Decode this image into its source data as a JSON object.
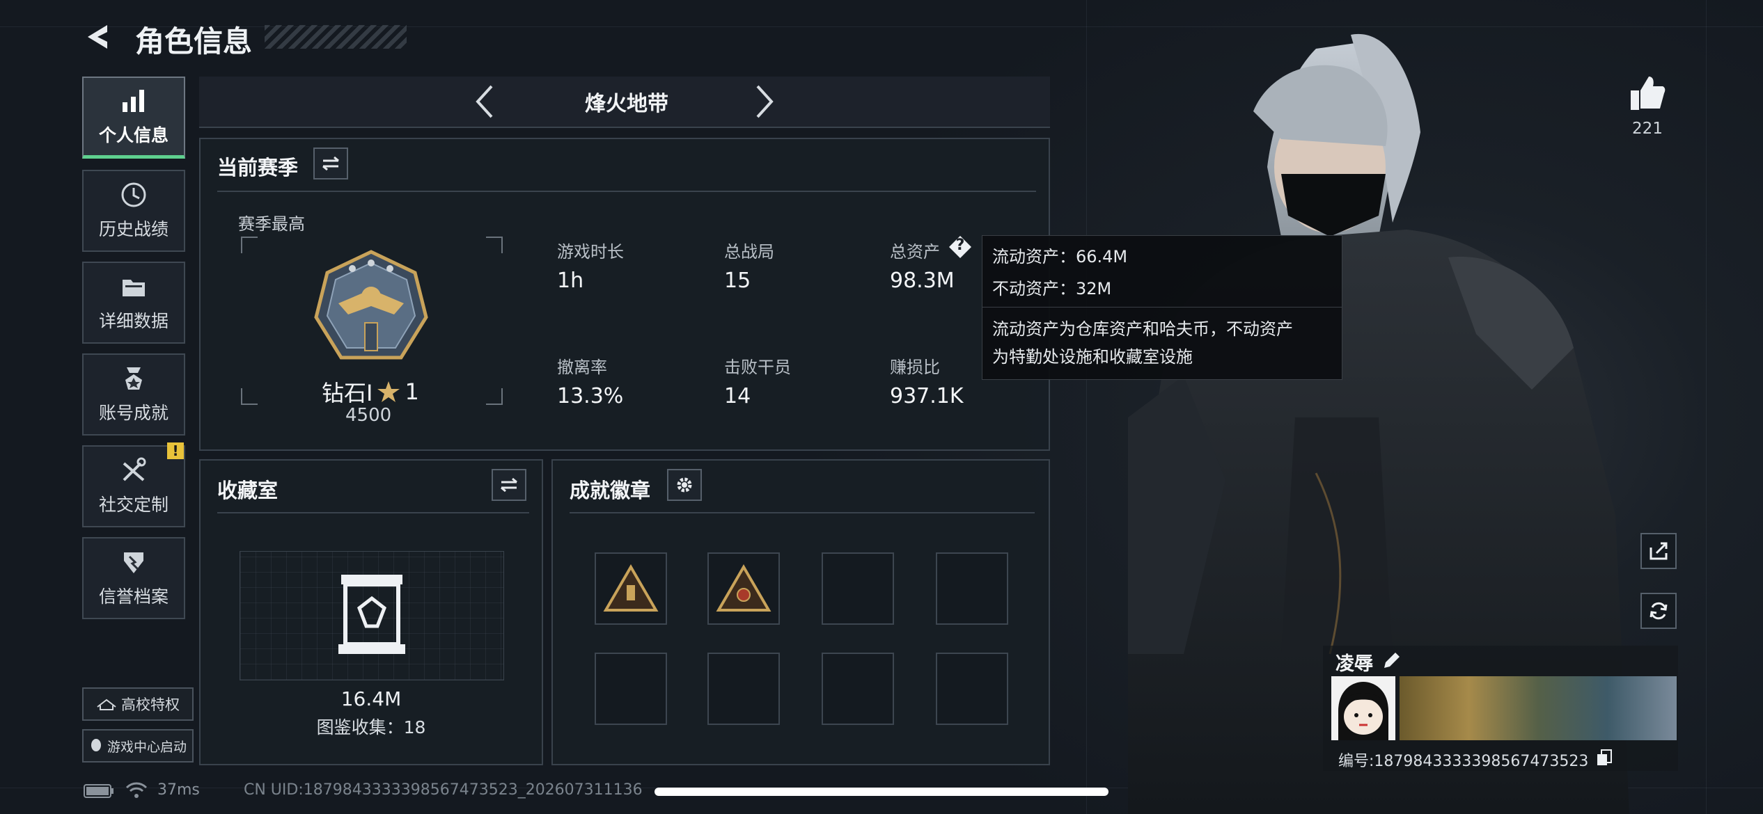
{
  "header": {
    "back_icon": "back-arrow-icon",
    "title": "角色信息"
  },
  "sidebar": {
    "items": [
      {
        "label": "个人信息",
        "icon": "bar-chart-icon",
        "active": true
      },
      {
        "label": "历史战绩",
        "icon": "clock-icon",
        "active": false
      },
      {
        "label": "详细数据",
        "icon": "folder-icon",
        "active": false
      },
      {
        "label": "账号成就",
        "icon": "medal-icon",
        "active": false
      },
      {
        "label": "社交定制",
        "icon": "tools-icon",
        "active": false,
        "alert": "!"
      },
      {
        "label": "信誉档案",
        "icon": "shield-icon",
        "active": false
      }
    ],
    "campus_button": "高校特权",
    "game_center_button": "游戏中心启动"
  },
  "mode_selector": {
    "title": "烽火地带",
    "prev_icon": "chevron-left-icon",
    "next_icon": "chevron-right-icon"
  },
  "season": {
    "title": "当前赛季",
    "best_label": "赛季最高",
    "rank_name": "钻石Ⅰ",
    "rank_stars": "1",
    "rank_points": "4500",
    "stats": [
      {
        "label": "游戏时长",
        "value": "1h"
      },
      {
        "label": "总战局",
        "value": "15"
      },
      {
        "label": "总资产",
        "value": "98.3M",
        "help": "?"
      },
      {
        "label": "撤离率",
        "value": "13.3%"
      },
      {
        "label": "击败干员",
        "value": "14"
      },
      {
        "label": "赚损比",
        "value": "937.1K"
      }
    ]
  },
  "tooltip": {
    "line1": "流动资产：66.4M",
    "line2": "不动资产：32M",
    "desc1": "流动资产为仓库资产和哈夫币，不动资产",
    "desc2": "为特勤处设施和收藏室设施"
  },
  "collection": {
    "title": "收藏室",
    "value": "16.4M",
    "count_text": "图鉴收集：18"
  },
  "achievements": {
    "title": "成就徽章",
    "filled": 2,
    "total": 8
  },
  "right": {
    "likes": "221",
    "player_name": "凌辱",
    "player_id": "编号:1879843333398567473523"
  },
  "status_bar": {
    "ping": "37ms",
    "uid": "CN UID:1879843333398567473523_202607311136"
  },
  "colors": {
    "accent_green": "#5fd18f",
    "alert_yellow": "#e8c23a",
    "gold": "#c9a35a"
  }
}
